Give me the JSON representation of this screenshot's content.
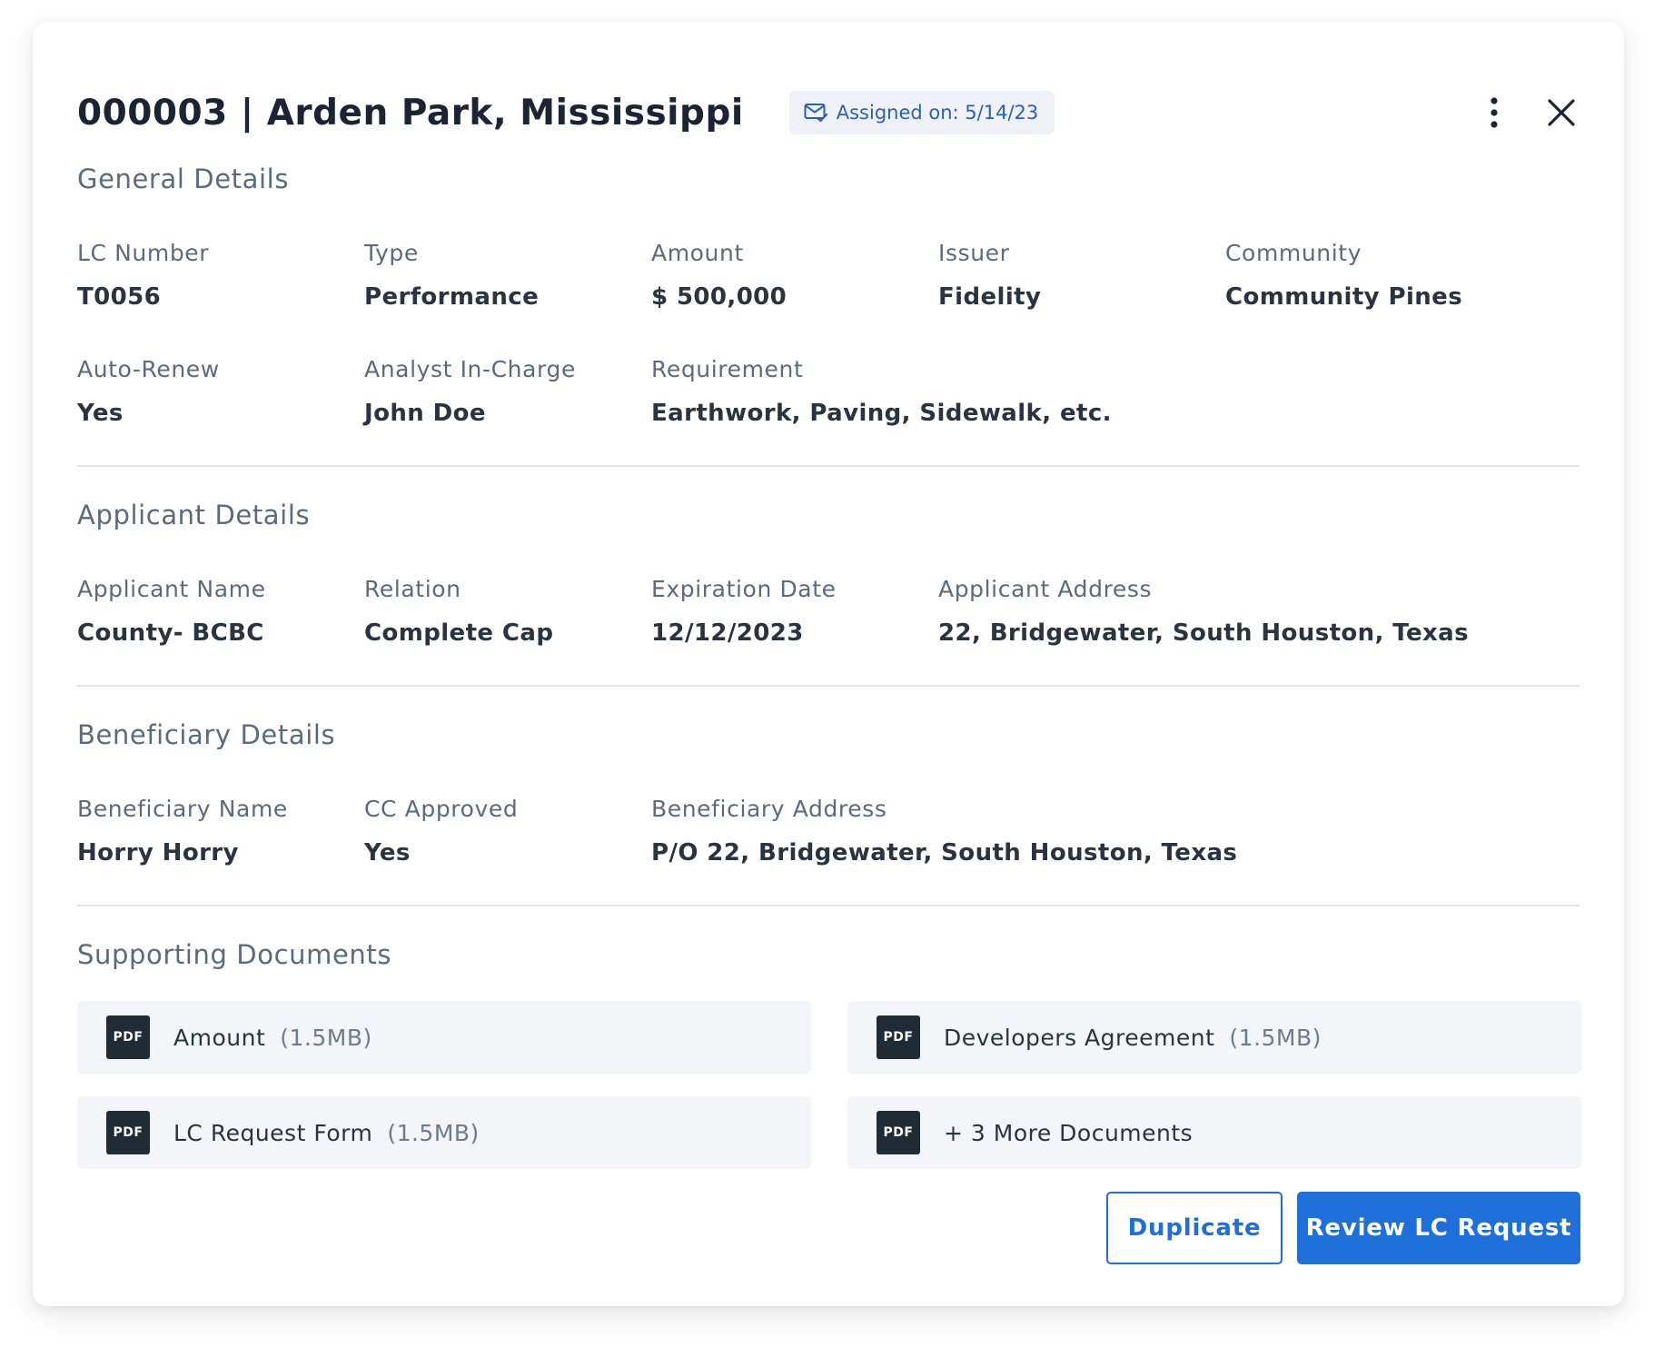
{
  "header": {
    "title": "000003 | Arden Park, Mississippi",
    "assigned": "Assigned on: 5/14/23",
    "icons": [
      "mail-check-icon",
      "more-vertical-icon",
      "close-icon"
    ]
  },
  "general": {
    "title": "General Details",
    "fields": [
      {
        "label": "LC Number",
        "value": "T0056"
      },
      {
        "label": "Type",
        "value": "Performance"
      },
      {
        "label": "Amount",
        "value": "$ 500,000"
      },
      {
        "label": "Issuer",
        "value": "Fidelity"
      },
      {
        "label": "Community",
        "value": "Community Pines"
      },
      {
        "label": "Auto-Renew",
        "value": "Yes"
      },
      {
        "label": "Analyst In-Charge",
        "value": "John Doe"
      },
      {
        "label": "Requirement",
        "value": "Earthwork, Paving, Sidewalk, etc."
      }
    ]
  },
  "applicant": {
    "title": "Applicant Details",
    "fields": [
      {
        "label": "Applicant Name",
        "value": "County- BCBC"
      },
      {
        "label": "Relation",
        "value": "Complete Cap"
      },
      {
        "label": "Expiration Date",
        "value": "12/12/2023"
      },
      {
        "label": "Applicant Address",
        "value": "22, Bridgewater, South Houston, Texas"
      }
    ]
  },
  "beneficiary": {
    "title": "Beneficiary Details",
    "fields": [
      {
        "label": "Beneficiary Name",
        "value": "Horry Horry"
      },
      {
        "label": "CC Approved",
        "value": "Yes"
      },
      {
        "label": "Beneficiary Address",
        "value": "P/O 22, Bridgewater, South Houston, Texas"
      }
    ]
  },
  "documents": {
    "title": "Supporting Documents",
    "badge": "PDF",
    "items": [
      {
        "name": "Amount",
        "size": "(1.5MB)"
      },
      {
        "name": "Developers Agreement",
        "size": "(1.5MB)"
      },
      {
        "name": "LC Request Form",
        "size": "(1.5MB)"
      },
      {
        "name": "+ 3 More Documents",
        "size": ""
      }
    ]
  },
  "actions": {
    "duplicate": "Duplicate",
    "review": "Review LC Request"
  },
  "colors": {
    "primary": "#1e6fd9",
    "title": "#1c2434",
    "label": "#5b6a7d",
    "badge_bg": "#eef1f6",
    "doc_bg": "#f3f5f8",
    "pdf_badge": "#1f2b35"
  }
}
